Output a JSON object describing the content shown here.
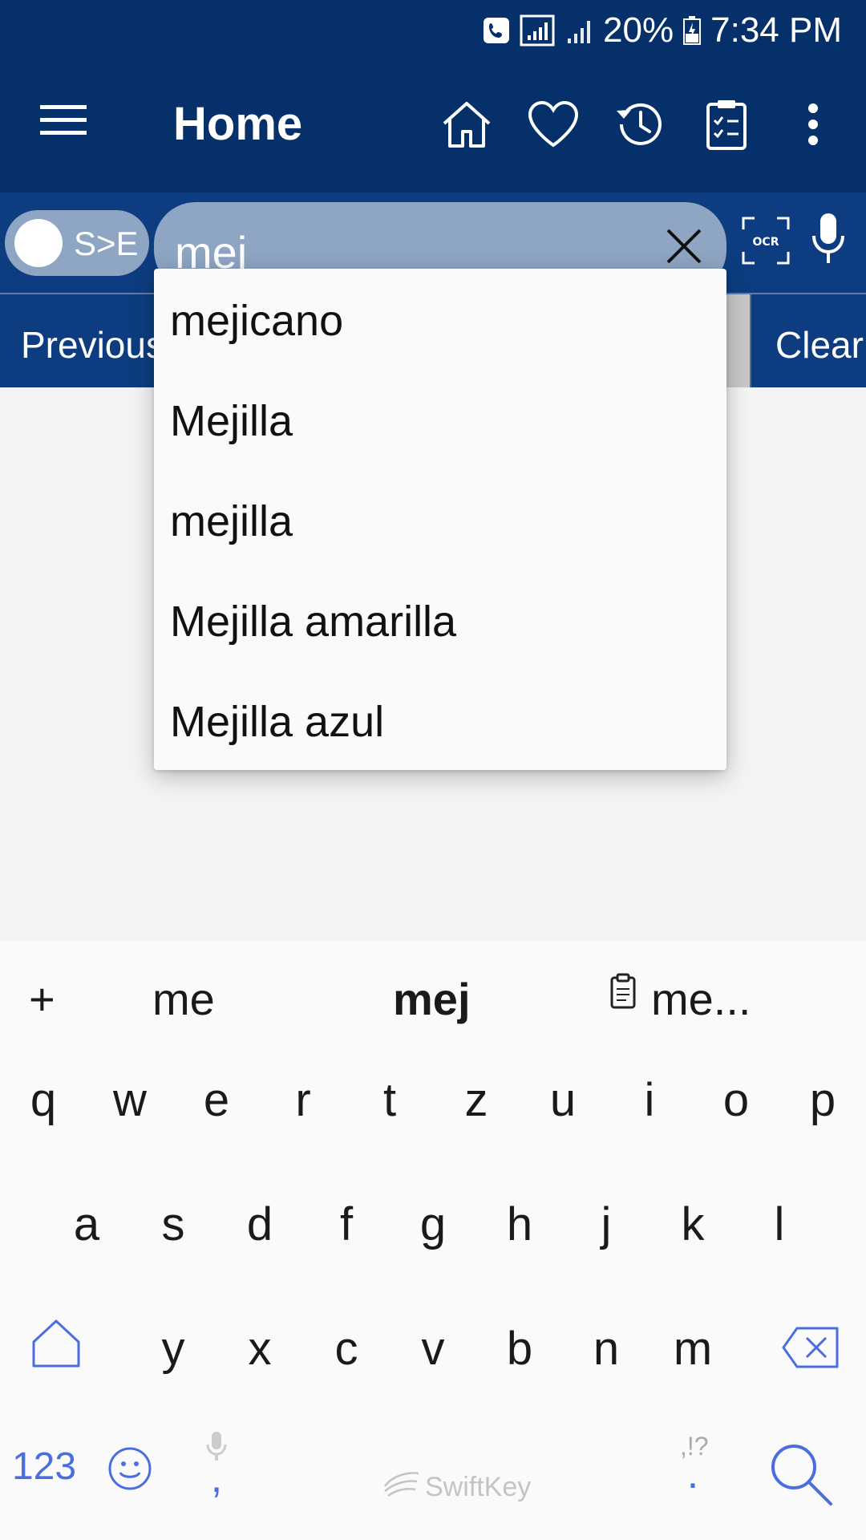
{
  "status_bar": {
    "battery": "20%",
    "time": "7:34 PM",
    "icons": [
      "call-icon",
      "signal-icon",
      "signal-icon",
      "battery-charging-icon"
    ]
  },
  "app_bar": {
    "title": "Home",
    "actions": [
      "home-icon",
      "heart-icon",
      "history-icon",
      "clipboard-check-icon",
      "more-vert-icon"
    ]
  },
  "search": {
    "direction_label": "S>E",
    "query": "mej"
  },
  "nav": {
    "previous_label": "Previous",
    "clear_label": "Clear"
  },
  "suggestions": [
    "mejicano",
    "Mejilla",
    "mejilla",
    "Mejilla amarilla",
    "Mejilla azul"
  ],
  "keyboard": {
    "predictions": {
      "add": "+",
      "left": "me",
      "center": "mej",
      "right": "me..."
    },
    "row1": [
      "q",
      "w",
      "e",
      "r",
      "t",
      "z",
      "u",
      "i",
      "o",
      "p"
    ],
    "row2": [
      "a",
      "s",
      "d",
      "f",
      "g",
      "h",
      "j",
      "k",
      "l"
    ],
    "row3": [
      "y",
      "x",
      "c",
      "v",
      "b",
      "n",
      "m"
    ],
    "numbers_label": "123",
    "comma": ",",
    "period": ".",
    "punct_hint": ",!?",
    "brand": "SwiftKey"
  },
  "colors": {
    "primary": "#06306a",
    "toolbar": "#0d3d80",
    "search_fill": "#8ea5c3",
    "keyboard_accent": "#4a6ee0"
  }
}
